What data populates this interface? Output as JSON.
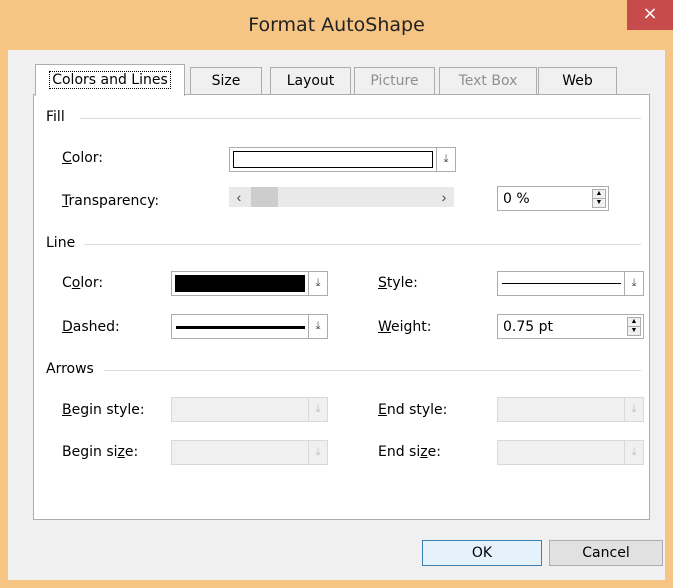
{
  "window": {
    "title": "Format AutoShape",
    "close_glyph": "×"
  },
  "tabs": [
    {
      "label": "Colors and Lines",
      "active": true,
      "enabled": true
    },
    {
      "label": "Size",
      "active": false,
      "enabled": true
    },
    {
      "label": "Layout",
      "active": false,
      "enabled": true
    },
    {
      "label": "Picture",
      "active": false,
      "enabled": false
    },
    {
      "label": "Text Box",
      "active": false,
      "enabled": false
    },
    {
      "label": "Web",
      "active": false,
      "enabled": true
    }
  ],
  "fill": {
    "section": "Fill",
    "color_label_pre": "",
    "color_label_u": "C",
    "color_label_post": "olor:",
    "color_value": "#ffffff",
    "transparency_label_pre": "",
    "transparency_label_u": "T",
    "transparency_label_post": "ransparency:",
    "transparency_value": "0 %",
    "transparency_slider_level": 0
  },
  "line": {
    "section": "Line",
    "color_label_pre": "C",
    "color_label_u": "o",
    "color_label_post": "lor:",
    "color_value": "#000000",
    "dashed_label_pre": "",
    "dashed_label_u": "D",
    "dashed_label_post": "ashed:",
    "style_label_pre": "",
    "style_label_u": "S",
    "style_label_post": "tyle:",
    "weight_label_pre": "",
    "weight_label_u": "W",
    "weight_label_post": "eight:",
    "weight_value": "0.75 pt"
  },
  "arrows": {
    "section": "Arrows",
    "begin_style_pre": "",
    "begin_style_u": "B",
    "begin_style_post": "egin style:",
    "begin_size_pre": "Begin si",
    "begin_size_u": "z",
    "begin_size_post": "e:",
    "end_style_pre": "",
    "end_style_u": "E",
    "end_style_post": "nd style:",
    "end_size_pre": "End si",
    "end_size_u": "z",
    "end_size_post": "e:"
  },
  "buttons": {
    "ok": "OK",
    "cancel": "Cancel"
  },
  "icons": {
    "dropdown": "chevron-down-icon",
    "scroll_left": "chevron-left-icon",
    "scroll_right": "chevron-right-icon",
    "spin_up": "spin-up-icon",
    "spin_down": "spin-down-icon",
    "close": "close-icon"
  },
  "colors": {
    "title_bar": "#f6c483",
    "close_button": "#c74b4b",
    "dialog": "#f0f0f0",
    "default_button_border": "#3c7fb1"
  }
}
